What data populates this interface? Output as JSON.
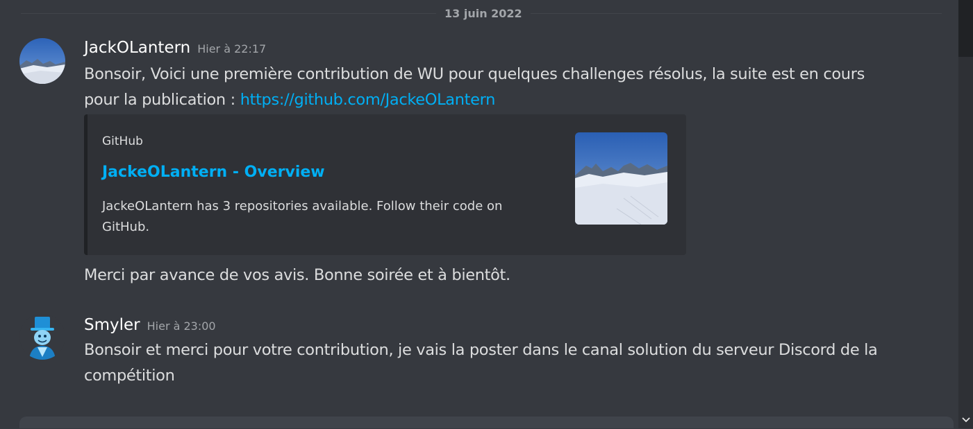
{
  "divider": {
    "date": "13 juin 2022"
  },
  "messages": [
    {
      "username": "JackOLantern",
      "timestamp": "Hier à 22:17",
      "text_line1": "Bonsoir, Voici une première contribution de WU pour quelques challenges résolus, la suite est en cours",
      "text_line2_prefix": "pour la publication : ",
      "link": "https://github.com/JackeOLantern",
      "embed": {
        "provider": "GitHub",
        "title": "JackeOLantern - Overview",
        "description": "JackeOLantern has 3 repositories available. Follow their code on GitHub."
      },
      "followup": "Merci par avance de vos avis. Bonne soirée et à bientôt."
    },
    {
      "username": "Smyler",
      "timestamp": "Hier à 23:00",
      "text": "Bonsoir et merci pour votre contribution, je vais la poster dans le canal solution du serveur Discord de la compétition"
    }
  ],
  "icons": {
    "scroll_down": "chevron-down-icon"
  },
  "colors": {
    "background": "#36393f",
    "link": "#00aff4",
    "username": "#ffffff",
    "timestamp": "#a3a6aa",
    "embed_bg": "#2f3136"
  }
}
